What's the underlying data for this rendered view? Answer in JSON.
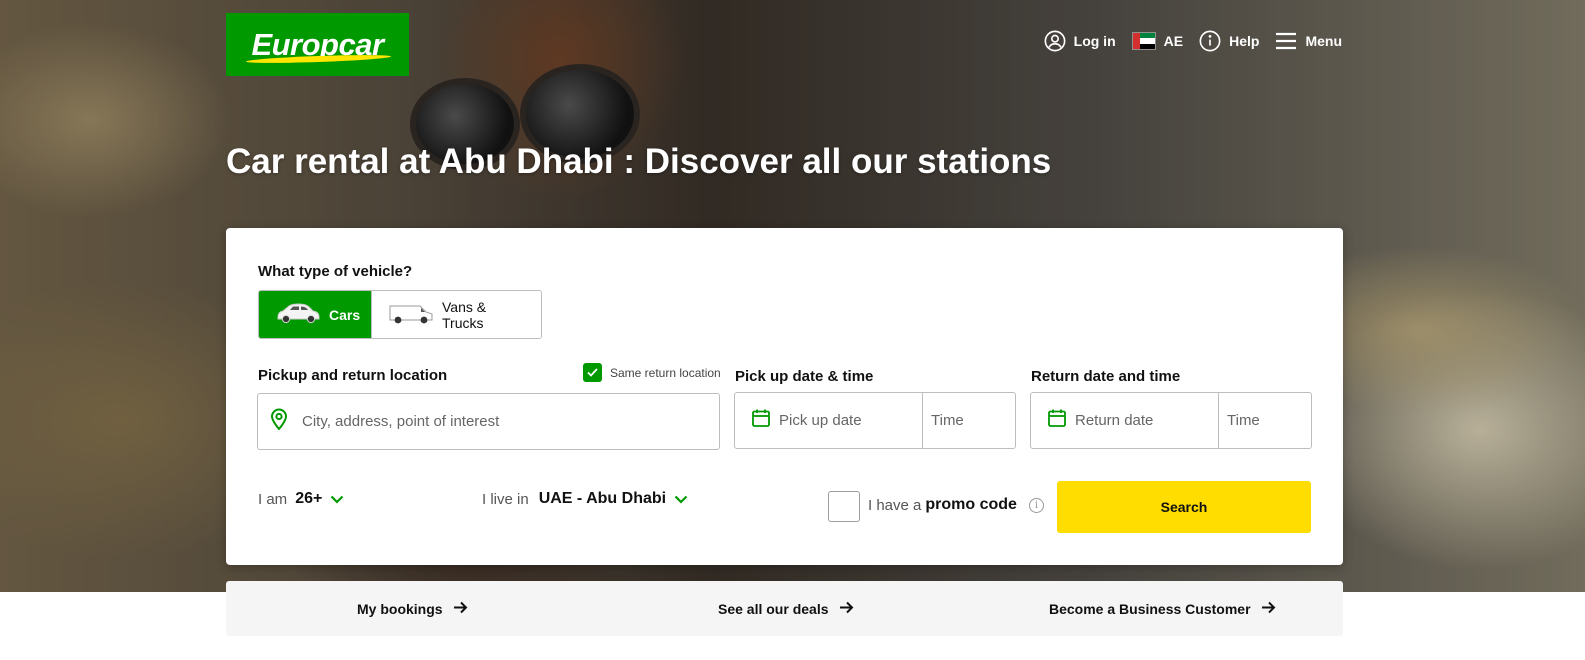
{
  "brand": {
    "name": "Europcar",
    "green": "#009900",
    "yellow": "#ffdd00"
  },
  "topnav": {
    "login": "Log in",
    "country": "AE",
    "help": "Help",
    "menu": "Menu"
  },
  "hero": {
    "title": "Car rental at Abu Dhabi : Discover all our stations"
  },
  "booking": {
    "vehicle_question": "What type of vehicle?",
    "vehicle_types": [
      {
        "label": "Cars",
        "selected": true,
        "icon": "car-icon"
      },
      {
        "label": "Vans & Trucks",
        "selected": false,
        "icon": "van-icon"
      }
    ],
    "location": {
      "label": "Pickup and return location",
      "same_return_label": "Same return location",
      "same_return_checked": true,
      "placeholder": "City, address, point of interest"
    },
    "pickup": {
      "label": "Pick up date & time",
      "date_placeholder": "Pick up date",
      "time_placeholder": "Time"
    },
    "return": {
      "label": "Return date and time",
      "date_placeholder": "Return date",
      "time_placeholder": "Time"
    },
    "age": {
      "prefix": "I am",
      "value": "26+"
    },
    "residence": {
      "prefix": "I live in",
      "value": "UAE - Abu Dhabi"
    },
    "promo": {
      "prefix": "I have a",
      "bold": "promo code",
      "checked": false
    },
    "search_label": "Search"
  },
  "quicklinks": [
    {
      "label": "My bookings"
    },
    {
      "label": "See all our deals"
    },
    {
      "label": "Become a Business Customer"
    }
  ]
}
